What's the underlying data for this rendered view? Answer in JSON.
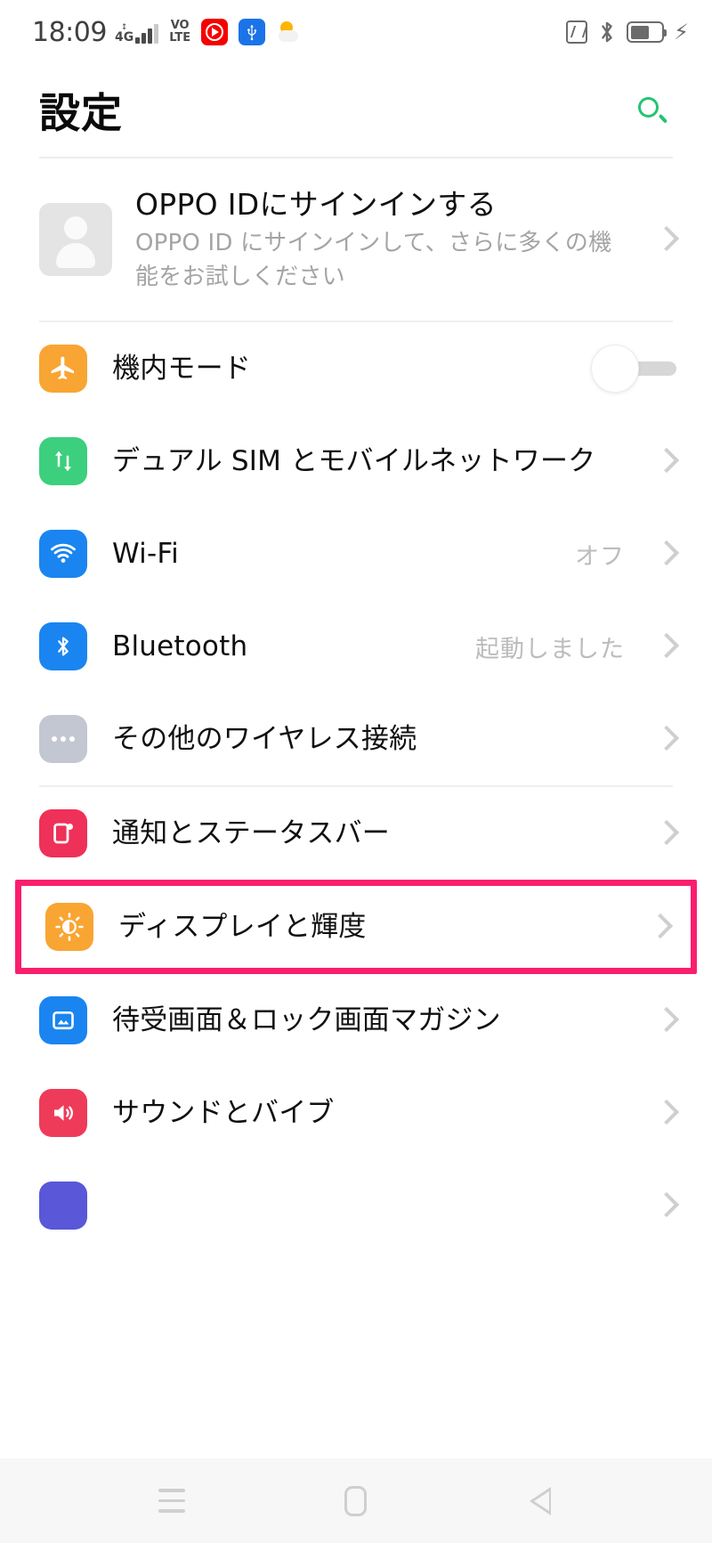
{
  "status_bar": {
    "time": "18:09",
    "network_type": "4G",
    "volte_top": "VO",
    "volte_bottom": "LTE",
    "icons": {
      "signal": "signal-bars-icon",
      "volte": "volte-icon",
      "youtube": "youtube-icon",
      "usb": "usb-icon",
      "weather": "weather-icon",
      "nfc": "nfc-icon",
      "bluetooth": "bluetooth-icon",
      "battery": "battery-icon",
      "charging": "charging-bolt-icon"
    },
    "battery_level_percent": 62
  },
  "header": {
    "title": "設定",
    "search_icon": "search-icon",
    "accent_color": "#22c474"
  },
  "account": {
    "title": "OPPO IDにサインインする",
    "subtitle": "OPPO ID にサインインして、さらに多くの機能をお試しください",
    "avatar_icon": "person-avatar-icon"
  },
  "groups": [
    {
      "id": "connectivity",
      "rows": [
        {
          "id": "airplane-mode",
          "label": "機内モード",
          "icon": "airplane-icon",
          "icon_color": "#f9a533",
          "control": "toggle",
          "toggle_on": false
        },
        {
          "id": "dual-sim",
          "label": "デュアル SIM とモバイルネットワーク",
          "icon": "data-transfer-icon",
          "icon_color": "#3ccf7e",
          "control": "chevron"
        },
        {
          "id": "wifi",
          "label": "Wi-Fi",
          "icon": "wifi-icon",
          "icon_color": "#1a85f0",
          "value": "オフ",
          "control": "chevron"
        },
        {
          "id": "bluetooth",
          "label": "Bluetooth",
          "icon": "bluetooth-icon",
          "icon_color": "#1a85f0",
          "value": "起動しました",
          "control": "chevron"
        },
        {
          "id": "other-wireless",
          "label": "その他のワイヤレス接続",
          "icon": "ellipsis-icon",
          "icon_color": "#c3c7d1",
          "control": "chevron"
        }
      ]
    },
    {
      "id": "device",
      "rows": [
        {
          "id": "notifications-status-bar",
          "label": "通知とステータスバー",
          "icon": "notification-icon",
          "icon_color": "#ef3058",
          "control": "chevron"
        },
        {
          "id": "display-brightness",
          "label": "ディスプレイと輝度",
          "icon": "brightness-icon",
          "icon_color": "#f9a533",
          "control": "chevron",
          "highlighted": true,
          "highlight_color": "#fb1e6e"
        },
        {
          "id": "wallpaper-lockscreen",
          "label": "待受画面＆ロック画面マガジン",
          "icon": "wallpaper-icon",
          "icon_color": "#1a85f0",
          "control": "chevron"
        },
        {
          "id": "sound-vibration",
          "label": "サウンドとバイブ",
          "icon": "speaker-icon",
          "icon_color": "#ef3b5a",
          "control": "chevron"
        }
      ]
    }
  ],
  "nav_bar": {
    "recents_icon": "recents-menu-icon",
    "home_icon": "home-icon",
    "back_icon": "back-icon"
  }
}
